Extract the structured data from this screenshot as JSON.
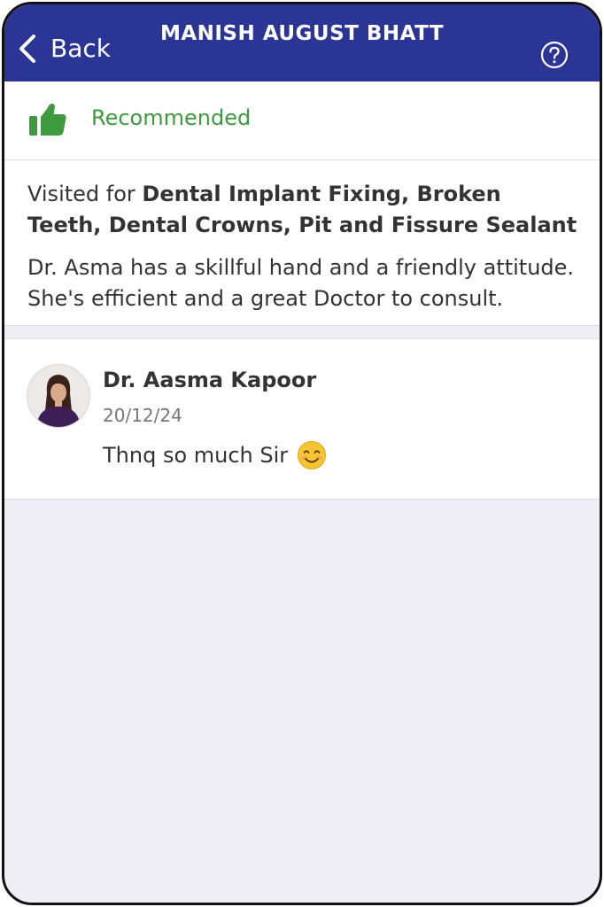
{
  "header": {
    "back_label": "Back",
    "title": "MANISH AUGUST BHATT"
  },
  "recommendation": {
    "label": "Recommended",
    "icon": "thumbs-up-icon"
  },
  "review": {
    "visited_prefix": "Visited for ",
    "treatments": "Dental Implant Fixing, Broken Teeth, Dental Crowns, Pit and Fissure Sealant",
    "body": "Dr. Asma has a skillful hand and a friendly attitude. She's efficient and a great Doctor to consult."
  },
  "reply": {
    "author": "Dr. Aasma Kapoor",
    "date": "20/12/24",
    "text": "Thnq so much Sir"
  },
  "colors": {
    "header_bg": "#2b3596",
    "recommend_green": "#3e9a3e",
    "page_bg": "#efeef4"
  }
}
